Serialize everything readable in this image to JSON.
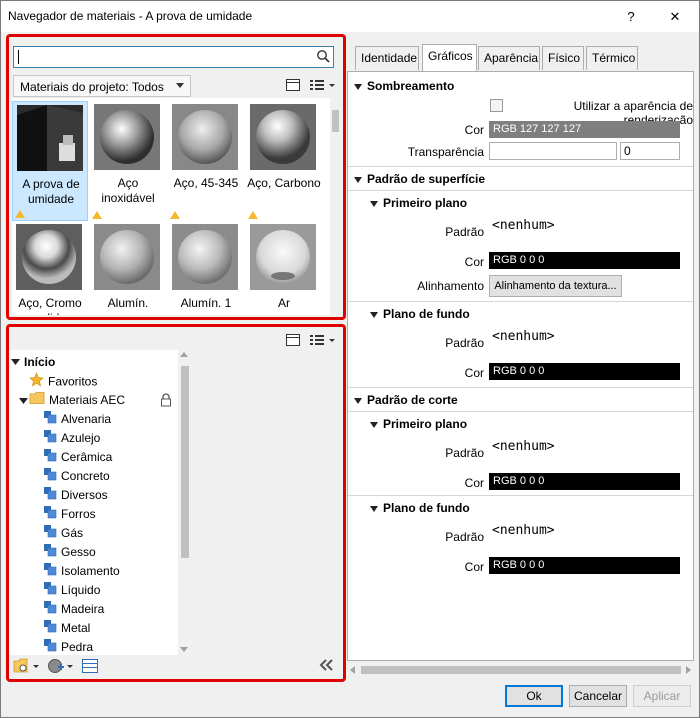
{
  "window": {
    "title": "Navegador de materiais - A prova de umidade",
    "help_label": "?",
    "close_label": "✕"
  },
  "search": {
    "value": "",
    "placeholder": ""
  },
  "library": {
    "breadcrumb": "Materiais do projeto: Todos"
  },
  "thumbnails": [
    {
      "label": "A prova de umidade",
      "selected": true
    },
    {
      "label": "Aço inoxidável"
    },
    {
      "label": "Aço, 45-345"
    },
    {
      "label": "Aço, Carbono"
    },
    {
      "label": "Aço, Cromo polido"
    },
    {
      "label": "Alumín."
    },
    {
      "label": "Alumín. 1"
    },
    {
      "label": "Ar"
    }
  ],
  "tree": {
    "root": "Início",
    "favorites": "Favoritos",
    "library": "Materiais AEC",
    "items": [
      "Alvenaria",
      "Azulejo",
      "Cerâmica",
      "Concreto",
      "Diversos",
      "Forros",
      "Gás",
      "Gesso",
      "Isolamento",
      "Líquido",
      "Madeira",
      "Metal",
      "Pedra"
    ]
  },
  "tabs": [
    "Identidade",
    "Gráficos",
    "Aparência",
    "Físico",
    "Térmico"
  ],
  "active_tab": "Gráficos",
  "shading": {
    "header": "Sombreamento",
    "use_render_label": "Utilizar a aparência de renderização",
    "color_label": "Cor",
    "color_value": "RGB 127 127 127",
    "transparency_label": "Transparência",
    "transparency_value": "0"
  },
  "surface": {
    "header": "Padrão de superfície",
    "fg": {
      "header": "Primeiro plano",
      "pattern_label": "Padrão",
      "pattern_value": "<nenhum>",
      "color_label": "Cor",
      "color_value": "RGB 0 0 0",
      "align_label": "Alinhamento",
      "align_button": "Alinhamento da textura..."
    },
    "bg": {
      "header": "Plano de fundo",
      "pattern_label": "Padrão",
      "pattern_value": "<nenhum>",
      "color_label": "Cor",
      "color_value": "RGB 0 0 0"
    }
  },
  "cut": {
    "header": "Padrão de corte",
    "fg": {
      "header": "Primeiro plano",
      "pattern_label": "Padrão",
      "pattern_value": "<nenhum>",
      "color_label": "Cor",
      "color_value": "RGB 0 0 0"
    },
    "bg": {
      "header": "Plano de fundo",
      "pattern_label": "Padrão",
      "pattern_value": "<nenhum>",
      "color_label": "Cor",
      "color_value": "RGB 0 0 0"
    }
  },
  "footer": {
    "ok": "Ok",
    "cancel": "Cancelar",
    "apply": "Aplicar"
  },
  "colors": {
    "highlight": "#e00000",
    "selection": "#cce8ff",
    "tree_icon": "#2f6db5"
  }
}
